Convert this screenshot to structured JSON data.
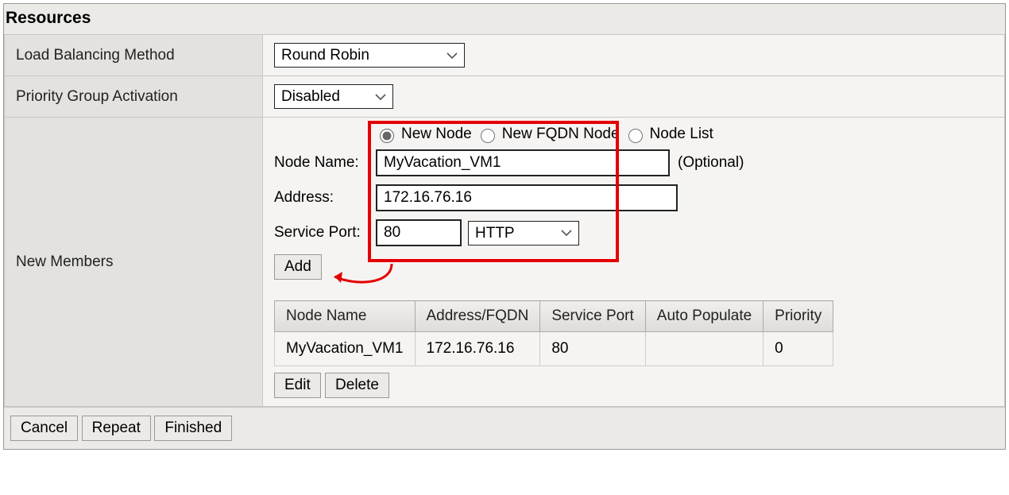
{
  "section_title": "Resources",
  "rows": {
    "lb_label": "Load Balancing Method",
    "pg_label": "Priority Group Activation",
    "nm_label": "New Members"
  },
  "load_balancing": {
    "value": "Round Robin"
  },
  "priority_group": {
    "value": "Disabled"
  },
  "node_type": {
    "new_node": "New Node",
    "new_fqdn": "New FQDN Node",
    "node_list": "Node List",
    "selected": "new_node"
  },
  "node_form": {
    "name_label": "Node Name:",
    "name_value": "MyVacation_VM1",
    "optional": "(Optional)",
    "addr_label": "Address:",
    "addr_value": "172.16.76.16",
    "port_label": "Service Port:",
    "port_value": "80",
    "port_proto": "HTTP"
  },
  "buttons": {
    "add": "Add",
    "edit": "Edit",
    "delete": "Delete",
    "cancel": "Cancel",
    "repeat": "Repeat",
    "finished": "Finished"
  },
  "member_table": {
    "headers": {
      "node_name": "Node Name",
      "addr": "Address/FQDN",
      "port": "Service Port",
      "auto": "Auto Populate",
      "priority": "Priority"
    },
    "row": {
      "node_name": "MyVacation_VM1",
      "addr": "172.16.76.16",
      "port": "80",
      "auto": "",
      "priority": "0"
    }
  }
}
